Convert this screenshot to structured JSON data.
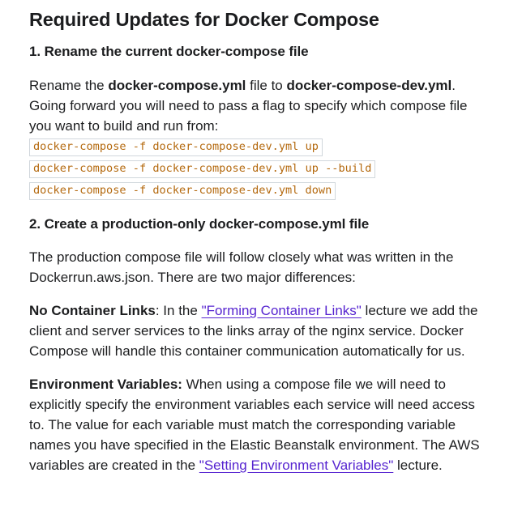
{
  "title": "Required Updates for Docker Compose",
  "step1": {
    "heading": "1. Rename the current docker-compose file",
    "text_before": "Rename the ",
    "file_old": "docker-compose.yml",
    "text_middle": " file to ",
    "file_new": "docker-compose-dev.yml",
    "text_after": ". Going forward you will need to pass a flag to specify which compose file you want to build and run from:",
    "commands": [
      "docker-compose -f docker-compose-dev.yml up",
      "docker-compose -f docker-compose-dev.yml up --build",
      "docker-compose -f docker-compose-dev.yml down"
    ]
  },
  "step2": {
    "heading": "2. Create a production-only docker-compose.yml file",
    "intro": "The production compose file will follow closely what was written in the Dockerrun.aws.json. There are two major differences:",
    "links_section": {
      "label": "No Container Links",
      "text_before": ": In the ",
      "link_text": "\"Forming Container Links\"",
      "text_after": " lecture we add the client and server services to the links array of the nginx service. Docker Compose will handle this container communication automatically for us."
    },
    "env_section": {
      "label": "Environment Variables:",
      "text_before": " When using a compose file we will need to explicitly specify the environment variables each service will need access to. The value for each variable must match the corresponding variable names you have specified in the Elastic Beanstalk environment. The AWS variables are created in the ",
      "link_text": "\"Setting Environment Variables\"",
      "text_after": " lecture."
    }
  },
  "colors": {
    "text": "#1c1d1f",
    "code_text": "#b4690e",
    "code_border": "#d1d7dc",
    "link": "#5624d0"
  }
}
